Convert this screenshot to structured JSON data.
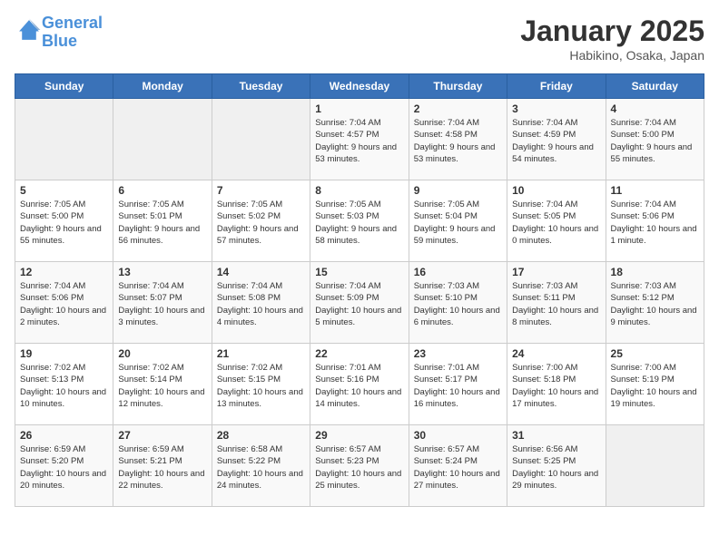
{
  "header": {
    "logo_line1": "General",
    "logo_line2": "Blue",
    "title": "January 2025",
    "subtitle": "Habikino, Osaka, Japan"
  },
  "days_of_week": [
    "Sunday",
    "Monday",
    "Tuesday",
    "Wednesday",
    "Thursday",
    "Friday",
    "Saturday"
  ],
  "weeks": [
    [
      {
        "num": "",
        "info": ""
      },
      {
        "num": "",
        "info": ""
      },
      {
        "num": "",
        "info": ""
      },
      {
        "num": "1",
        "info": "Sunrise: 7:04 AM\nSunset: 4:57 PM\nDaylight: 9 hours and 53 minutes."
      },
      {
        "num": "2",
        "info": "Sunrise: 7:04 AM\nSunset: 4:58 PM\nDaylight: 9 hours and 53 minutes."
      },
      {
        "num": "3",
        "info": "Sunrise: 7:04 AM\nSunset: 4:59 PM\nDaylight: 9 hours and 54 minutes."
      },
      {
        "num": "4",
        "info": "Sunrise: 7:04 AM\nSunset: 5:00 PM\nDaylight: 9 hours and 55 minutes."
      }
    ],
    [
      {
        "num": "5",
        "info": "Sunrise: 7:05 AM\nSunset: 5:00 PM\nDaylight: 9 hours and 55 minutes."
      },
      {
        "num": "6",
        "info": "Sunrise: 7:05 AM\nSunset: 5:01 PM\nDaylight: 9 hours and 56 minutes."
      },
      {
        "num": "7",
        "info": "Sunrise: 7:05 AM\nSunset: 5:02 PM\nDaylight: 9 hours and 57 minutes."
      },
      {
        "num": "8",
        "info": "Sunrise: 7:05 AM\nSunset: 5:03 PM\nDaylight: 9 hours and 58 minutes."
      },
      {
        "num": "9",
        "info": "Sunrise: 7:05 AM\nSunset: 5:04 PM\nDaylight: 9 hours and 59 minutes."
      },
      {
        "num": "10",
        "info": "Sunrise: 7:04 AM\nSunset: 5:05 PM\nDaylight: 10 hours and 0 minutes."
      },
      {
        "num": "11",
        "info": "Sunrise: 7:04 AM\nSunset: 5:06 PM\nDaylight: 10 hours and 1 minute."
      }
    ],
    [
      {
        "num": "12",
        "info": "Sunrise: 7:04 AM\nSunset: 5:06 PM\nDaylight: 10 hours and 2 minutes."
      },
      {
        "num": "13",
        "info": "Sunrise: 7:04 AM\nSunset: 5:07 PM\nDaylight: 10 hours and 3 minutes."
      },
      {
        "num": "14",
        "info": "Sunrise: 7:04 AM\nSunset: 5:08 PM\nDaylight: 10 hours and 4 minutes."
      },
      {
        "num": "15",
        "info": "Sunrise: 7:04 AM\nSunset: 5:09 PM\nDaylight: 10 hours and 5 minutes."
      },
      {
        "num": "16",
        "info": "Sunrise: 7:03 AM\nSunset: 5:10 PM\nDaylight: 10 hours and 6 minutes."
      },
      {
        "num": "17",
        "info": "Sunrise: 7:03 AM\nSunset: 5:11 PM\nDaylight: 10 hours and 8 minutes."
      },
      {
        "num": "18",
        "info": "Sunrise: 7:03 AM\nSunset: 5:12 PM\nDaylight: 10 hours and 9 minutes."
      }
    ],
    [
      {
        "num": "19",
        "info": "Sunrise: 7:02 AM\nSunset: 5:13 PM\nDaylight: 10 hours and 10 minutes."
      },
      {
        "num": "20",
        "info": "Sunrise: 7:02 AM\nSunset: 5:14 PM\nDaylight: 10 hours and 12 minutes."
      },
      {
        "num": "21",
        "info": "Sunrise: 7:02 AM\nSunset: 5:15 PM\nDaylight: 10 hours and 13 minutes."
      },
      {
        "num": "22",
        "info": "Sunrise: 7:01 AM\nSunset: 5:16 PM\nDaylight: 10 hours and 14 minutes."
      },
      {
        "num": "23",
        "info": "Sunrise: 7:01 AM\nSunset: 5:17 PM\nDaylight: 10 hours and 16 minutes."
      },
      {
        "num": "24",
        "info": "Sunrise: 7:00 AM\nSunset: 5:18 PM\nDaylight: 10 hours and 17 minutes."
      },
      {
        "num": "25",
        "info": "Sunrise: 7:00 AM\nSunset: 5:19 PM\nDaylight: 10 hours and 19 minutes."
      }
    ],
    [
      {
        "num": "26",
        "info": "Sunrise: 6:59 AM\nSunset: 5:20 PM\nDaylight: 10 hours and 20 minutes."
      },
      {
        "num": "27",
        "info": "Sunrise: 6:59 AM\nSunset: 5:21 PM\nDaylight: 10 hours and 22 minutes."
      },
      {
        "num": "28",
        "info": "Sunrise: 6:58 AM\nSunset: 5:22 PM\nDaylight: 10 hours and 24 minutes."
      },
      {
        "num": "29",
        "info": "Sunrise: 6:57 AM\nSunset: 5:23 PM\nDaylight: 10 hours and 25 minutes."
      },
      {
        "num": "30",
        "info": "Sunrise: 6:57 AM\nSunset: 5:24 PM\nDaylight: 10 hours and 27 minutes."
      },
      {
        "num": "31",
        "info": "Sunrise: 6:56 AM\nSunset: 5:25 PM\nDaylight: 10 hours and 29 minutes."
      },
      {
        "num": "",
        "info": ""
      }
    ]
  ]
}
